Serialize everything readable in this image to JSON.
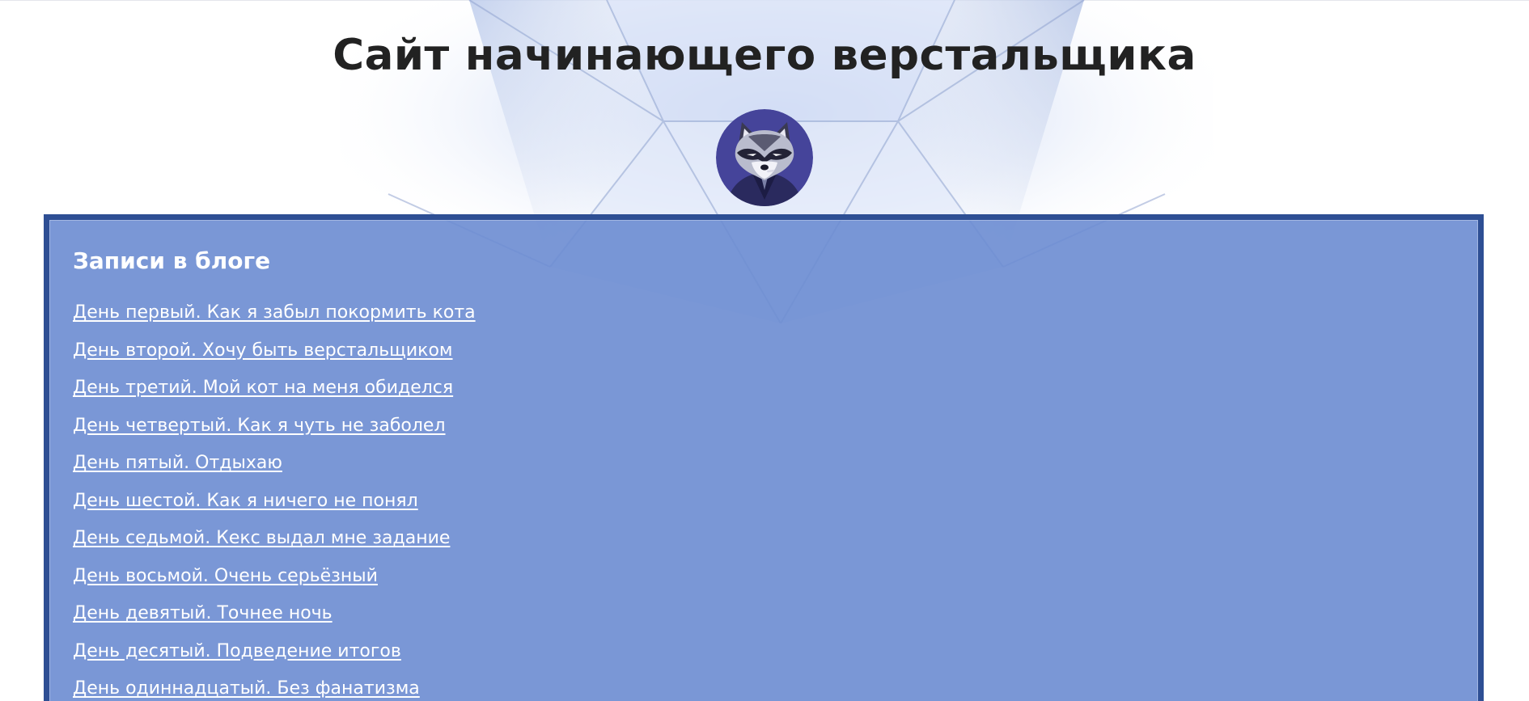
{
  "header": {
    "site_title": "Сайт начинающего верстальщика",
    "avatar_icon": "raccoon-avatar-icon"
  },
  "blog": {
    "title": "Записи в блоге",
    "posts": [
      "День первый. Как я забыл покормить кота",
      "День второй. Хочу быть верстальщиком",
      "День третий. Мой кот на меня обиделся",
      "День четвертый. Как я чуть не заболел",
      "День пятый. Отдыхаю",
      "День шестой. Как я ничего не понял",
      "День седьмой. Кекс выдал мне задание",
      "День восьмой. Очень серьёзный",
      "День девятый. Точнее ночь",
      "День десятый. Подведение итогов",
      "День одиннадцатый. Без фанатизма"
    ]
  },
  "colors": {
    "panel_background": "#7b9ad6",
    "panel_border": "#2e4f94",
    "title_text": "#222222",
    "link_text": "#ffffff",
    "avatar_background": "#45449a"
  }
}
